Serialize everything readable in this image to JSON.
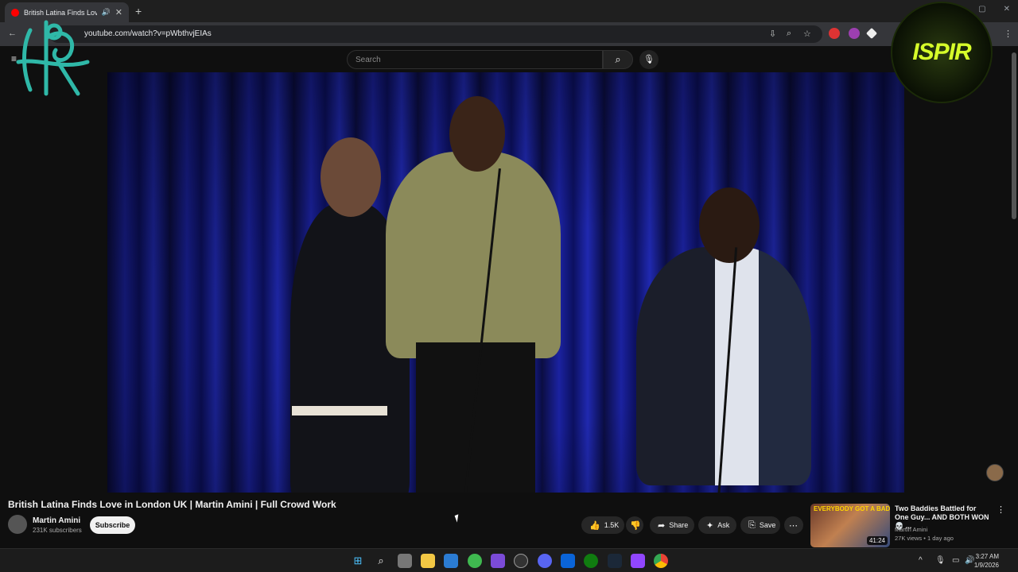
{
  "browser": {
    "tab_title": "British Latina Finds Love in",
    "url": "youtube.com/watch?v=pWbthvjEIAs",
    "new_tab_label": "+"
  },
  "youtube": {
    "search_placeholder": "Search",
    "video_title": "British Latina Finds Love in London UK | Martin Amini | Full Crowd Work",
    "channel_name": "Martin Amini",
    "channel_subs": "231K subscribers",
    "subscribe_label": "Subscribe",
    "like_count": "1.5K",
    "share_label": "Share",
    "ask_label": "Ask",
    "save_label": "Save"
  },
  "recommendation": {
    "thumb_caption": "EVERYBODY GOT A BADDIE",
    "duration": "41:24",
    "title": "Two Baddies Battled for One Guy... AND BOTH WON 💀 ...",
    "channel": "Martin Amini",
    "meta": "27K views • 1 day ago"
  },
  "overlays": {
    "right_logo_text": "ISPIR"
  },
  "taskbar": {
    "time": "3:27 AM",
    "date": "1/9/2026"
  },
  "colors": {
    "accent_red": "#ff0000",
    "background": "#0f0f0f",
    "stage_blue": "#1b22a0"
  }
}
